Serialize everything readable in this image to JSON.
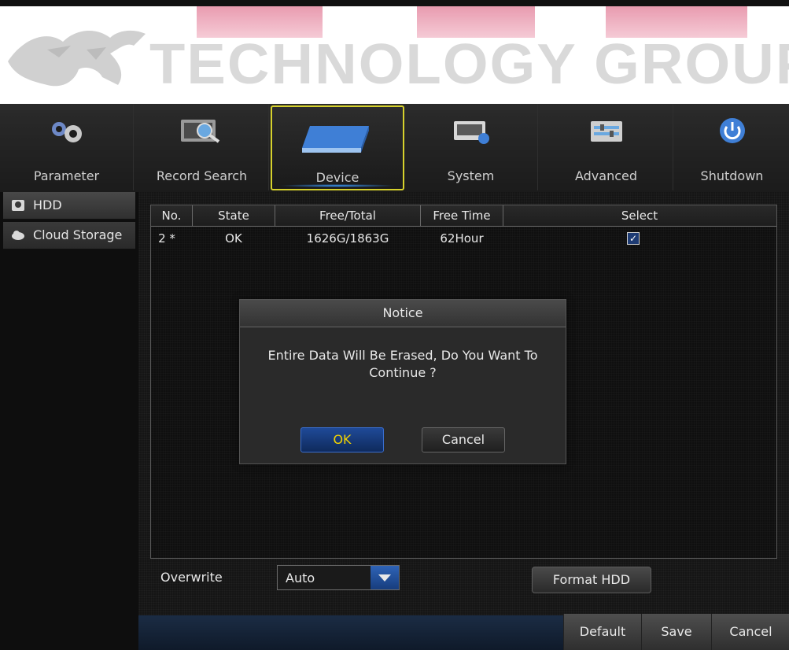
{
  "watermark": {
    "text": "TECHNOLOGY GROUP"
  },
  "nav": {
    "tabs": [
      {
        "label": "Parameter",
        "icon": "gears-icon"
      },
      {
        "label": "Record Search",
        "icon": "record-search-icon"
      },
      {
        "label": "Device",
        "icon": "hard-drive-icon",
        "active": true
      },
      {
        "label": "System",
        "icon": "system-info-icon"
      },
      {
        "label": "Advanced",
        "icon": "advanced-settings-icon"
      },
      {
        "label": "Shutdown",
        "icon": "power-icon"
      }
    ]
  },
  "sidebar": {
    "items": [
      {
        "label": "HDD",
        "icon": "hdd-icon",
        "active": true
      },
      {
        "label": "Cloud Storage",
        "icon": "cloud-storage-icon"
      }
    ]
  },
  "hdd_table": {
    "columns": [
      "No.",
      "State",
      "Free/Total",
      "Free Time",
      "Select"
    ],
    "rows": [
      {
        "no": "2 *",
        "state": "OK",
        "free_total": "1626G/1863G",
        "free_time": "62Hour",
        "selected": true
      }
    ]
  },
  "controls": {
    "overwrite_label": "Overwrite",
    "overwrite_value": "Auto",
    "format_label": "Format HDD"
  },
  "footer": {
    "default_label": "Default",
    "save_label": "Save",
    "cancel_label": "Cancel"
  },
  "modal": {
    "title": "Notice",
    "message": "Entire Data Will Be Erased, Do You Want To Continue ?",
    "ok_label": "OK",
    "cancel_label": "Cancel"
  },
  "colors": {
    "active_tab_border": "#d6d12c",
    "accent_blue": "#2e63b6",
    "ok_text": "#f2d300"
  }
}
